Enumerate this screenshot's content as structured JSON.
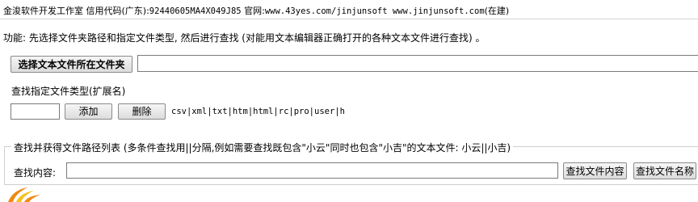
{
  "header": {
    "company": "金浚软件开发工作室",
    "credit_label": "信用代码(广东):",
    "credit_code": "92440605MA4X049J85",
    "site_label": "官网:",
    "site_urls": "www.43yes.com/jinjunsoft  www.jinjunsoft.com",
    "site_note": "(在建)"
  },
  "description": "功能: 先选择文件夹路径和指定文件类型, 然后进行查找 (对能用文本编辑器正确打开的各种文本文件进行查找) 。",
  "folder": {
    "select_button_label": "选择文本文件所在文件夹",
    "path_value": ""
  },
  "extensions": {
    "label": "查找指定文件类型(扩展名)",
    "input_value": "",
    "add_label": "添加",
    "delete_label": "删除",
    "list_text": "csv|xml|txt|htm|html|rc|pro|user|h"
  },
  "search": {
    "legend": "查找并获得文件路径列表 (多条件查找用||分隔,例如需要查找既包含\"小云\"同时也包含\"小吉\"的文本文件: 小云||小吉)",
    "label": "查找内容:",
    "input_value": "",
    "find_content_label": "查找文件内容",
    "find_name_label": "查找文件名称"
  },
  "colors": {
    "logo_orange": "#f08a12",
    "logo_yellow": "#f6c21a",
    "border": "#7a7a7a"
  }
}
